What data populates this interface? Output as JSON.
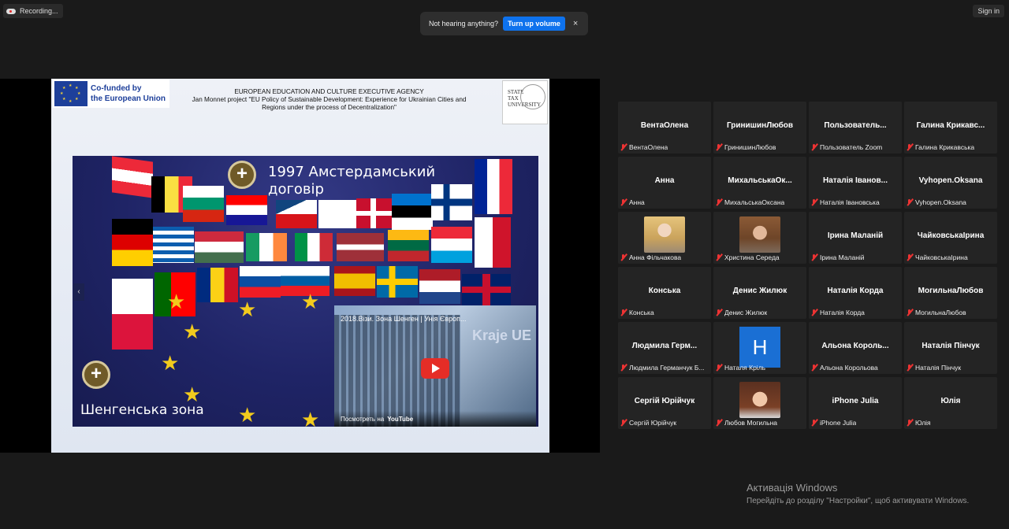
{
  "topbar": {
    "recording_label": "Recording...",
    "signin_label": "Sign in"
  },
  "toast": {
    "message": "Not hearing anything?",
    "button_label": "Turn up volume",
    "close_glyph": "×"
  },
  "slide": {
    "eu_logo_line1": "Co-funded by",
    "eu_logo_line2": "the European Union",
    "agency_line1": "EUROPEAN EDUCATION AND CULTURE EXECUTIVE AGENCY",
    "agency_line2": "Jan Monnet project \"EU Policy of Sustainable Development: Experience for Ukrainian Cities and",
    "agency_line3": "Regions under the process of Decentralization\"",
    "university_line1": "STATE",
    "university_line2": "TAX",
    "university_line3": "UNIVERSITY",
    "heading1_line1": "1997 Амстердамський",
    "heading1_line2": "договір",
    "heading2": "Шенгенська зона",
    "plus_glyph": "+",
    "star_glyph": "★",
    "nav_glyph": "‹",
    "video": {
      "title": "2018.Візи. Зона Шенген | Унія Європ...",
      "overlay_text": "Kraje UE",
      "watch_label": "Посмотреть на",
      "watch_brand": "YouTube"
    }
  },
  "participants": [
    {
      "display": "ВентаОлена",
      "label": "ВентаОлена"
    },
    {
      "display": "ГринишинЛюбов",
      "label": "ГринишинЛюбов"
    },
    {
      "display": "Пользователь...",
      "label": "Пользователь Zoom"
    },
    {
      "display": "Галина Крикавс...",
      "label": "Галина Крикавська"
    },
    {
      "display": "Анна",
      "label": "Анна"
    },
    {
      "display": "МихальськаОк...",
      "label": "МихальськаОксана"
    },
    {
      "display": "Наталія Іванов...",
      "label": "Наталія Івановська"
    },
    {
      "display": "Vyhopen.Oksana",
      "label": "Vyhopen.Oksana"
    },
    {
      "display": "",
      "label": "Анна Фільчакова",
      "photo": "blonde-woman"
    },
    {
      "display": "",
      "label": "Христина Середа",
      "photo": "curly-woman"
    },
    {
      "display": "Ірина Маланій",
      "label": "Ірина Маланій"
    },
    {
      "display": "ЧайковськаІрина",
      "label": "ЧайковськаІрина"
    },
    {
      "display": "Конська",
      "label": "Конська"
    },
    {
      "display": "Денис Жилюк",
      "label": "Денис Жилюк"
    },
    {
      "display": "Наталія Корда",
      "label": "Наталія Корда"
    },
    {
      "display": "МогильнаЛюбов",
      "label": "МогильнаЛюбов"
    },
    {
      "display": "Людмила Герм...",
      "label": "Людмила Германчук Б..."
    },
    {
      "display": "",
      "label": "Наталя Кріль",
      "avatar_letter": "H"
    },
    {
      "display": "Альона Король...",
      "label": "Альона Корольова"
    },
    {
      "display": "Наталія Пінчук",
      "label": "Наталія Пінчук"
    },
    {
      "display": "Сергій Юрійчук",
      "label": "Сергій Юрійчук"
    },
    {
      "display": "",
      "label": "Любов Могильна",
      "photo": "dark-hair-woman"
    },
    {
      "display": "iPhone Julia",
      "label": "iPhone Julia"
    },
    {
      "display": "Юлія",
      "label": "Юлія"
    }
  ],
  "windows_activation": {
    "line1": "Активація Windows",
    "line2": "Перейдіть до розділу \"Настройки\", щоб активувати Windows."
  },
  "colors": {
    "accent_button": "#0e72ed",
    "muted_mic": "#e33333",
    "avatar_blue": "#1a6fd4",
    "background": "#1a1a1a",
    "tile": "#242424"
  }
}
